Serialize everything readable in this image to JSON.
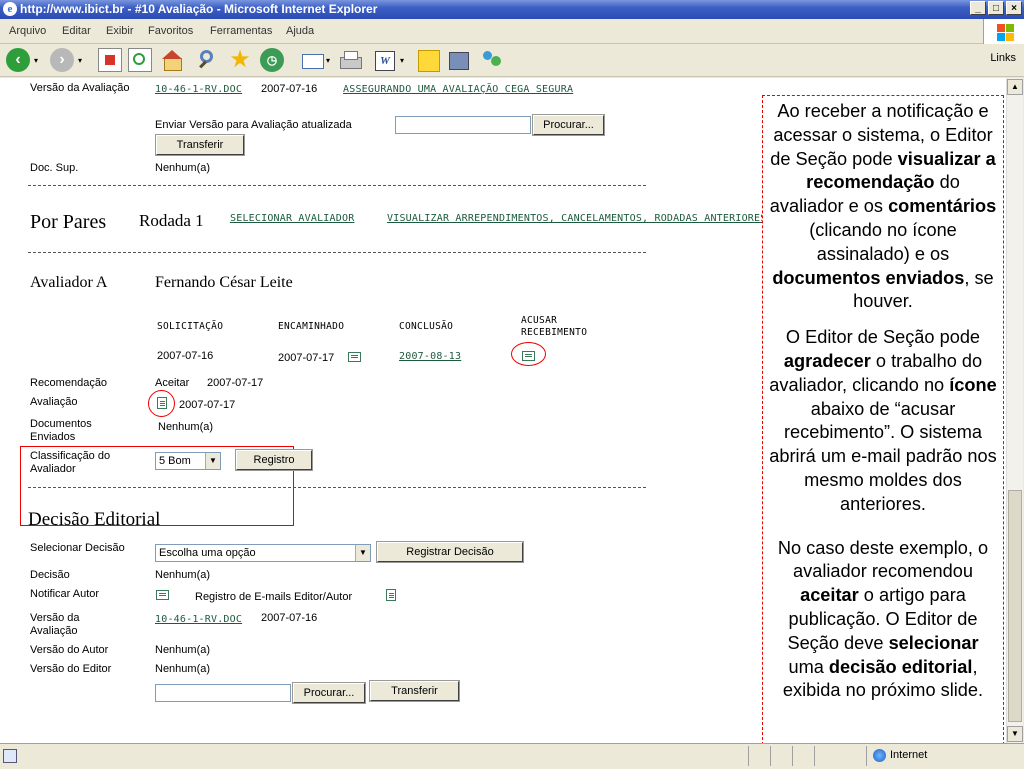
{
  "window": {
    "title": "http://www.ibict.br - #10 Avaliação - Microsoft Internet Explorer",
    "min": "_",
    "max": "□",
    "close": "×"
  },
  "menu": [
    "Arquivo",
    "Editar",
    "Exibir",
    "Favoritos",
    "Ferramentas",
    "Ajuda"
  ],
  "toolbar": {
    "links_label": "Links"
  },
  "status": {
    "zone": "Internet"
  },
  "review_version": {
    "label": "Versão da Avaliação",
    "file": "10-46-1-RV.DOC",
    "date": "2007-07-16",
    "link": "ASSEGURANDO UMA AVALIAÇÃO CEGA SEGURA",
    "upload_label": "Enviar Versão para Avaliação atualizada",
    "browse": "Procurar...",
    "transfer": "Transferir"
  },
  "doc_sup": {
    "label": "Doc. Sup.",
    "value": "Nenhum(a)"
  },
  "peer": {
    "title": "Por Pares",
    "round": "Rodada 1",
    "select_reviewer": "SELECIONAR AVALIADOR",
    "view_regrets": "VISUALIZAR ARREPENDIMENTOS, CANCELAMENTOS, RODADAS ANTERIORES"
  },
  "reviewer": {
    "label": "Avaliador A",
    "name": "Fernando César Leite",
    "cols": {
      "requested": "SOLICITAÇÃO",
      "forwarded": "ENCAMINHADO",
      "completed": "CONCLUSÃO",
      "ack_1": "ACUSAR",
      "ack_2": "RECEBIMENTO"
    },
    "requested": "2007-07-16",
    "forwarded": "2007-07-17",
    "completed": "2007-08-13",
    "recommendation_label": "Recomendação",
    "recommendation": "Aceitar",
    "recommendation_date": "2007-07-17",
    "review_label": "Avaliação",
    "review_date": "2007-07-17",
    "docs_label_1": "Documentos",
    "docs_label_2": "Enviados",
    "docs": "Nenhum(a)",
    "rating_label_1": "Classificação do",
    "rating_label_2": "Avaliador",
    "rating": "5 Bom",
    "register": "Registro"
  },
  "editorial": {
    "title": "Decisão Editorial",
    "select_label": "Selecionar Decisão",
    "select_value": "Escolha uma opção",
    "register_decision": "Registrar Decisão",
    "decision_label": "Decisão",
    "decision": "Nenhum(a)",
    "notify_label": "Notificar Autor",
    "email_log": "Registro de E-mails Editor/Autor",
    "review_version_label_1": "Versão da",
    "review_version_label_2": "Avaliação",
    "review_version_file": "10-46-1-RV.DOC",
    "review_version_date": "2007-07-16",
    "author_version_label": "Versão do Autor",
    "author_version": "Nenhum(a)",
    "editor_version_label": "Versão do Editor",
    "editor_version": "Nenhum(a)",
    "browse": "Procurar...",
    "transfer": "Transferir"
  },
  "note": {
    "p1": [
      {
        "t": "Ao receber a notificação e acessar o sistema, o Editor de Seção pode ",
        "b": false
      },
      {
        "t": "visualizar a recomendação",
        "b": true
      },
      {
        "t": " do avaliador e os ",
        "b": false
      },
      {
        "t": "comentários",
        "b": true
      },
      {
        "t": " (clicando no ícone assinalado) e os ",
        "b": false
      },
      {
        "t": "documentos enviados",
        "b": true
      },
      {
        "t": ", se houver.",
        "b": false
      }
    ],
    "p2": [
      {
        "t": "O Editor de Seção pode ",
        "b": false
      },
      {
        "t": "agradecer",
        "b": true
      },
      {
        "t": " o trabalho do avaliador, clicando no ",
        "b": false
      },
      {
        "t": "ícone",
        "b": true
      },
      {
        "t": " abaixo de “acusar recebimento”. O sistema abrirá um e-mail padrão nos mesmo moldes dos anteriores.",
        "b": false
      }
    ],
    "p3": [
      {
        "t": "No caso deste exemplo, o avaliador recomendou ",
        "b": false
      },
      {
        "t": "aceitar",
        "b": true
      },
      {
        "t": " o artigo para publicação. O Editor de Seção deve ",
        "b": false
      },
      {
        "t": "selecionar",
        "b": true
      },
      {
        "t": " uma ",
        "b": false
      },
      {
        "t": "decisão editorial",
        "b": true
      },
      {
        "t": ", exibida no próximo slide.",
        "b": false
      }
    ]
  },
  "colors": {
    "link": "#1d5a3e",
    "annotation": "#e00000",
    "titlebar": "#2a4bb4"
  }
}
